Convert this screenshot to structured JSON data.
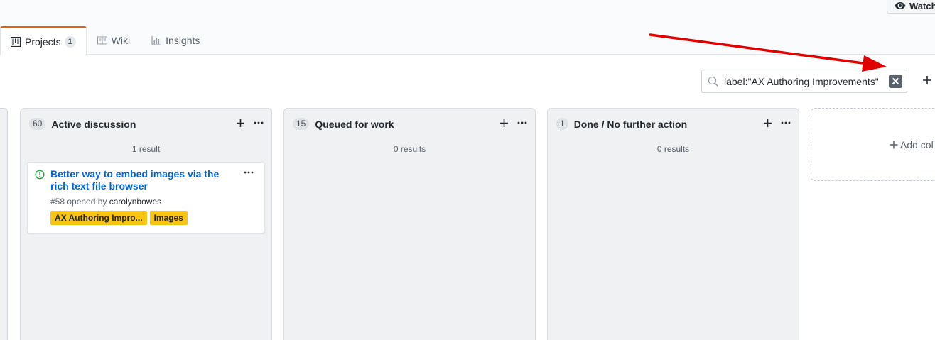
{
  "header": {
    "watch_label": "Watch"
  },
  "tabs": [
    {
      "label": "Projects",
      "count": "1",
      "icon": "project-icon",
      "selected": true
    },
    {
      "label": "Wiki",
      "icon": "book-icon",
      "selected": false
    },
    {
      "label": "Insights",
      "icon": "graph-icon",
      "selected": false
    }
  ],
  "filter": {
    "value": "label:\"AX Authoring Improvements\""
  },
  "columns": [
    {
      "count": "60",
      "title": "Active discussion",
      "results": "1 result",
      "cards": [
        {
          "title": "Better way to embed images via the rich text file browser",
          "meta_prefix": "#58 opened by",
          "author": "carolynbowes",
          "labels": [
            "AX Authoring Impro...",
            "Images"
          ]
        }
      ]
    },
    {
      "count": "15",
      "title": "Queued for work",
      "results": "0 results",
      "cards": []
    },
    {
      "count": "1",
      "title": "Done / No further action",
      "results": "0 results",
      "cards": []
    }
  ],
  "add_column_label": "Add col",
  "colors": {
    "accent_tab": "#e36209",
    "link": "#0366d6",
    "label_yellow": "#f9c513",
    "arrow": "#e00000",
    "open_issue": "#28a745"
  }
}
